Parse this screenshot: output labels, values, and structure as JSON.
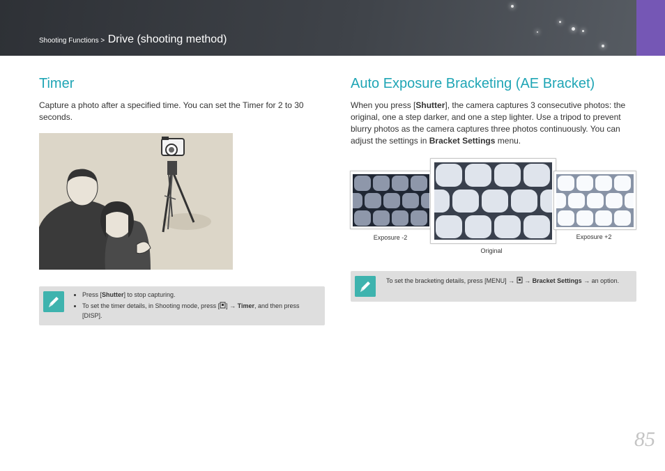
{
  "header": {
    "breadcrumb_section": "Shooting Functions >",
    "breadcrumb_page": "Drive (shooting method)",
    "accent_color": "#7557b5"
  },
  "timer": {
    "title": "Timer",
    "body": "Capture a photo after a specified time. You can set the Timer for 2 to 30 seconds.",
    "note_bullet_1_pre": "Press [",
    "note_bullet_1_bold": "Shutter",
    "note_bullet_1_post": "] to stop capturing.",
    "note_bullet_2_pre": "To set the timer details, in Shooting mode, press [",
    "note_bullet_2_mid": "] → ",
    "note_bullet_2_bold": "Timer",
    "note_bullet_2_post": ", and then press [DISP]."
  },
  "ae_bracket": {
    "title": "Auto Exposure Bracketing (AE Bracket)",
    "body_1": "When you press [",
    "body_bold_1": "Shutter",
    "body_2": "], the camera captures 3 consecutive photos: the original, one a step darker, and one a step lighter. Use a tripod to prevent blurry photos as the camera captures three photos continuously. You can adjust the settings in ",
    "body_bold_2": "Bracket Settings",
    "body_3": " menu.",
    "captions": [
      "Exposure -2",
      "Original",
      "Exposure +2"
    ],
    "note_pre": "To set the bracketing details, press [MENU] → ",
    "note_arrow": " → ",
    "note_bold": "Bracket Settings",
    "note_post": " → an option."
  },
  "page_number": "85",
  "icons": [
    "pencil-note-icon",
    "drive-mode-icon"
  ]
}
